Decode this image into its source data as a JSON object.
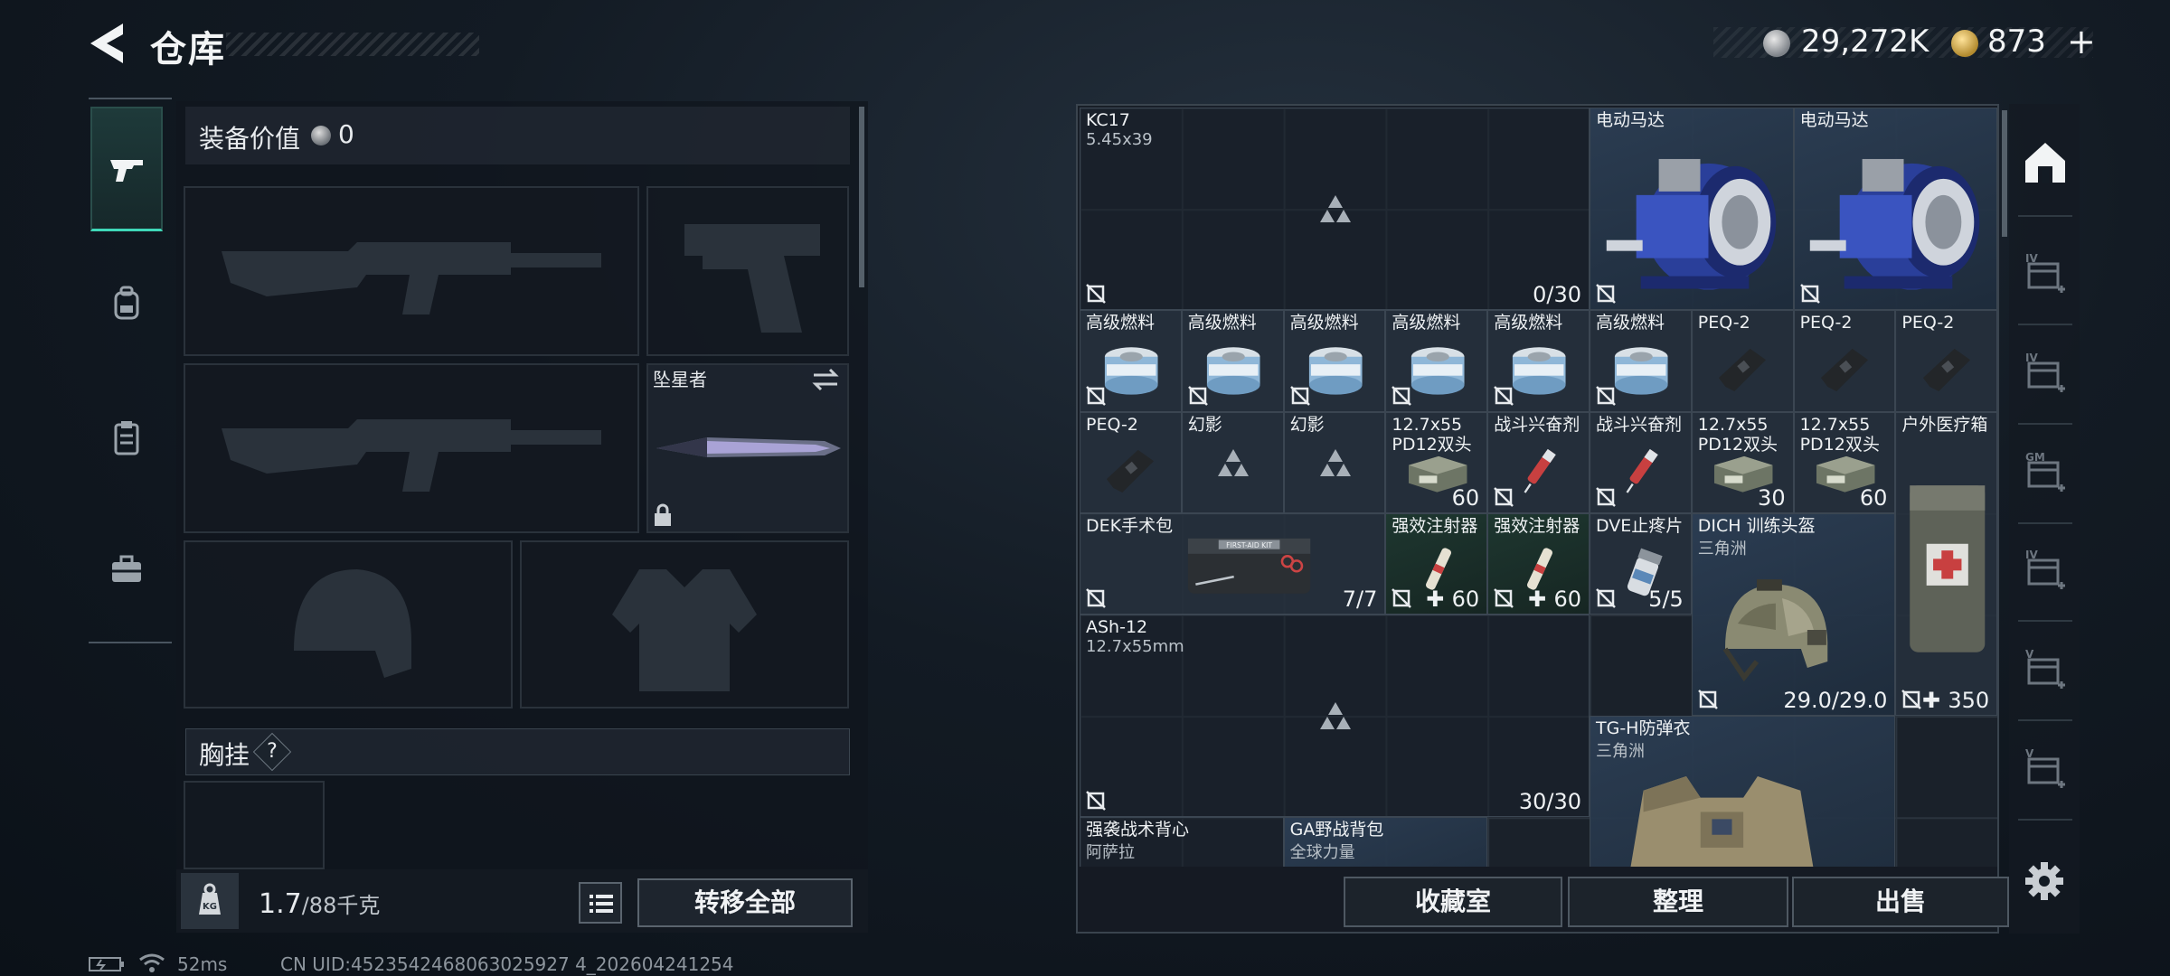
{
  "header": {
    "title": "仓库",
    "currency_silver": "29,272K",
    "currency_gold": "873",
    "plus_label": "+"
  },
  "equipment": {
    "value_label": "装备价值",
    "value": "0",
    "knife_name": "坠星者",
    "chest_label": "胸挂",
    "help_label": "?"
  },
  "bottom_left": {
    "weight_current": "1.7",
    "weight_max": "/88千克",
    "weight_icon_text": "KG",
    "transfer_all": "转移全部"
  },
  "status": {
    "ping": "52ms",
    "uid": "CN UID:4523542468063025927 4_202604241254"
  },
  "inventory": {
    "items": [
      {
        "name": "KC17",
        "sub": "5.45x39",
        "count": "0/30",
        "no_insure": true,
        "style": "empty",
        "logo": true
      },
      {
        "name": "电动马达",
        "style": "blue",
        "no_insure": true,
        "icon": "motor"
      },
      {
        "name": "电动马达",
        "style": "blue",
        "no_insure": true,
        "icon": "motor"
      },
      {
        "name": "高级燃料",
        "icon": "fuel-can",
        "no_insure": true
      },
      {
        "name": "高级燃料",
        "icon": "fuel-can",
        "no_insure": true
      },
      {
        "name": "高级燃料",
        "icon": "fuel-can",
        "no_insure": true
      },
      {
        "name": "高级燃料",
        "icon": "fuel-can",
        "no_insure": true
      },
      {
        "name": "高级燃料",
        "icon": "fuel-can",
        "no_insure": true
      },
      {
        "name": "高级燃料",
        "icon": "fuel-can",
        "no_insure": true
      },
      {
        "name": "PEQ-2",
        "icon": "peq"
      },
      {
        "name": "PEQ-2",
        "icon": "peq"
      },
      {
        "name": "PEQ-2",
        "icon": "peq"
      },
      {
        "name": "PEQ-2",
        "icon": "peq"
      },
      {
        "name": "幻影",
        "logo": true
      },
      {
        "name": "幻影",
        "logo": true
      },
      {
        "name": "12.7x55",
        "name2": "PD12双头",
        "count": "60",
        "icon": "ammo-box"
      },
      {
        "name": "战斗兴奋剂",
        "icon": "syringe",
        "no_insure": true
      },
      {
        "name": "战斗兴奋剂",
        "icon": "syringe",
        "no_insure": true
      },
      {
        "name": "12.7x55",
        "name2": "PD12双头",
        "count": "30",
        "icon": "ammo-box"
      },
      {
        "name": "12.7x55",
        "name2": "PD12双头",
        "count": "60",
        "icon": "ammo-box"
      },
      {
        "name": "户外医疗箱",
        "count": "350",
        "count_plus": true,
        "no_insure": true,
        "icon": "med-box"
      },
      {
        "name": "DEK手术包",
        "count": "7/7",
        "no_insure": true,
        "icon": "surgery-kit",
        "kit_text": "FIRST-AID KIT"
      },
      {
        "name": "强效注射器",
        "count": "60",
        "count_plus": true,
        "no_insure": true,
        "style": "green",
        "icon": "injector"
      },
      {
        "name": "强效注射器",
        "count": "60",
        "count_plus": true,
        "no_insure": true,
        "style": "green",
        "icon": "injector"
      },
      {
        "name": "DVE止疼片",
        "count": "5/5",
        "no_insure": true,
        "icon": "pill-bottle"
      },
      {
        "name": "DICH 训练头盔",
        "sub": "三角洲",
        "count": "29.0/29.0",
        "no_insure": true,
        "style": "blue",
        "icon": "helmet"
      },
      {
        "name": "ASh-12",
        "sub": "12.7x55mm",
        "count": "30/30",
        "no_insure": true,
        "style": "empty",
        "logo": true
      },
      {
        "name": "TG-H防弹衣",
        "sub": "三角洲",
        "style": "blue",
        "icon": "vest"
      },
      {
        "name": "强袭战术背心",
        "sub": "阿萨拉",
        "style": "empty"
      },
      {
        "name": "GA野战背包",
        "sub": "全球力量",
        "style": "blue"
      }
    ]
  },
  "bottom_right": {
    "collection": "收藏室",
    "organize": "整理",
    "sell": "出售"
  },
  "right_nav": {
    "labels": [
      "IV",
      "IV",
      "GM",
      "IV",
      "V",
      "V"
    ]
  }
}
